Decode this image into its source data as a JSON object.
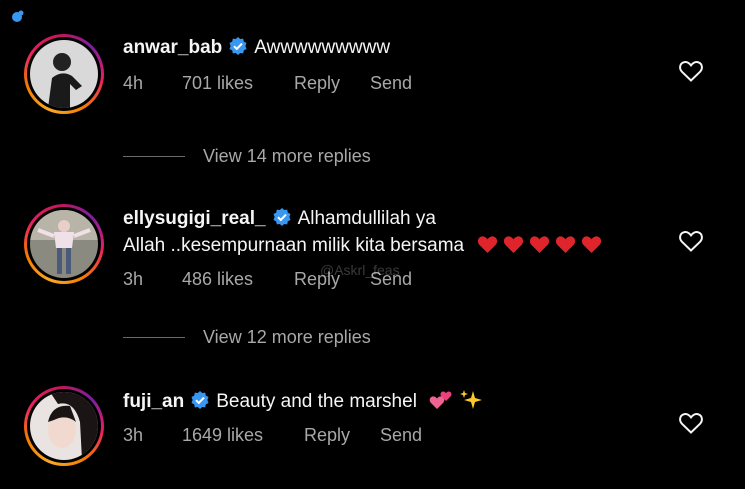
{
  "comments": [
    {
      "username": "anwar_bab",
      "text": "Awwwwwwwww",
      "time": "4h",
      "likes": "701 likes",
      "reply": "Reply",
      "send": "Send",
      "view_replies": "View 14 more replies"
    },
    {
      "username": "ellysugigi_real_",
      "text_line1": "Alhamdullilah ya",
      "text_line2": "Allah ..kesempurnaan milik kita bersama",
      "time": "3h",
      "likes": "486 likes",
      "reply": "Reply",
      "send": "Send",
      "view_replies": "View 12 more replies"
    },
    {
      "username": "fuji_an",
      "text": "Beauty and the marshel",
      "time": "3h",
      "likes": "1649 likes",
      "reply": "Reply",
      "send": "Send"
    }
  ],
  "watermark": "@Askrl_feas",
  "colors": {
    "background": "#000000",
    "verified": "#3897f0",
    "meta_text": "#a8a8a8"
  },
  "icons": [
    "verified-badge-icon",
    "heart-outline-icon",
    "red-heart-emoji",
    "two-hearts-emoji",
    "sparkles-emoji"
  ]
}
